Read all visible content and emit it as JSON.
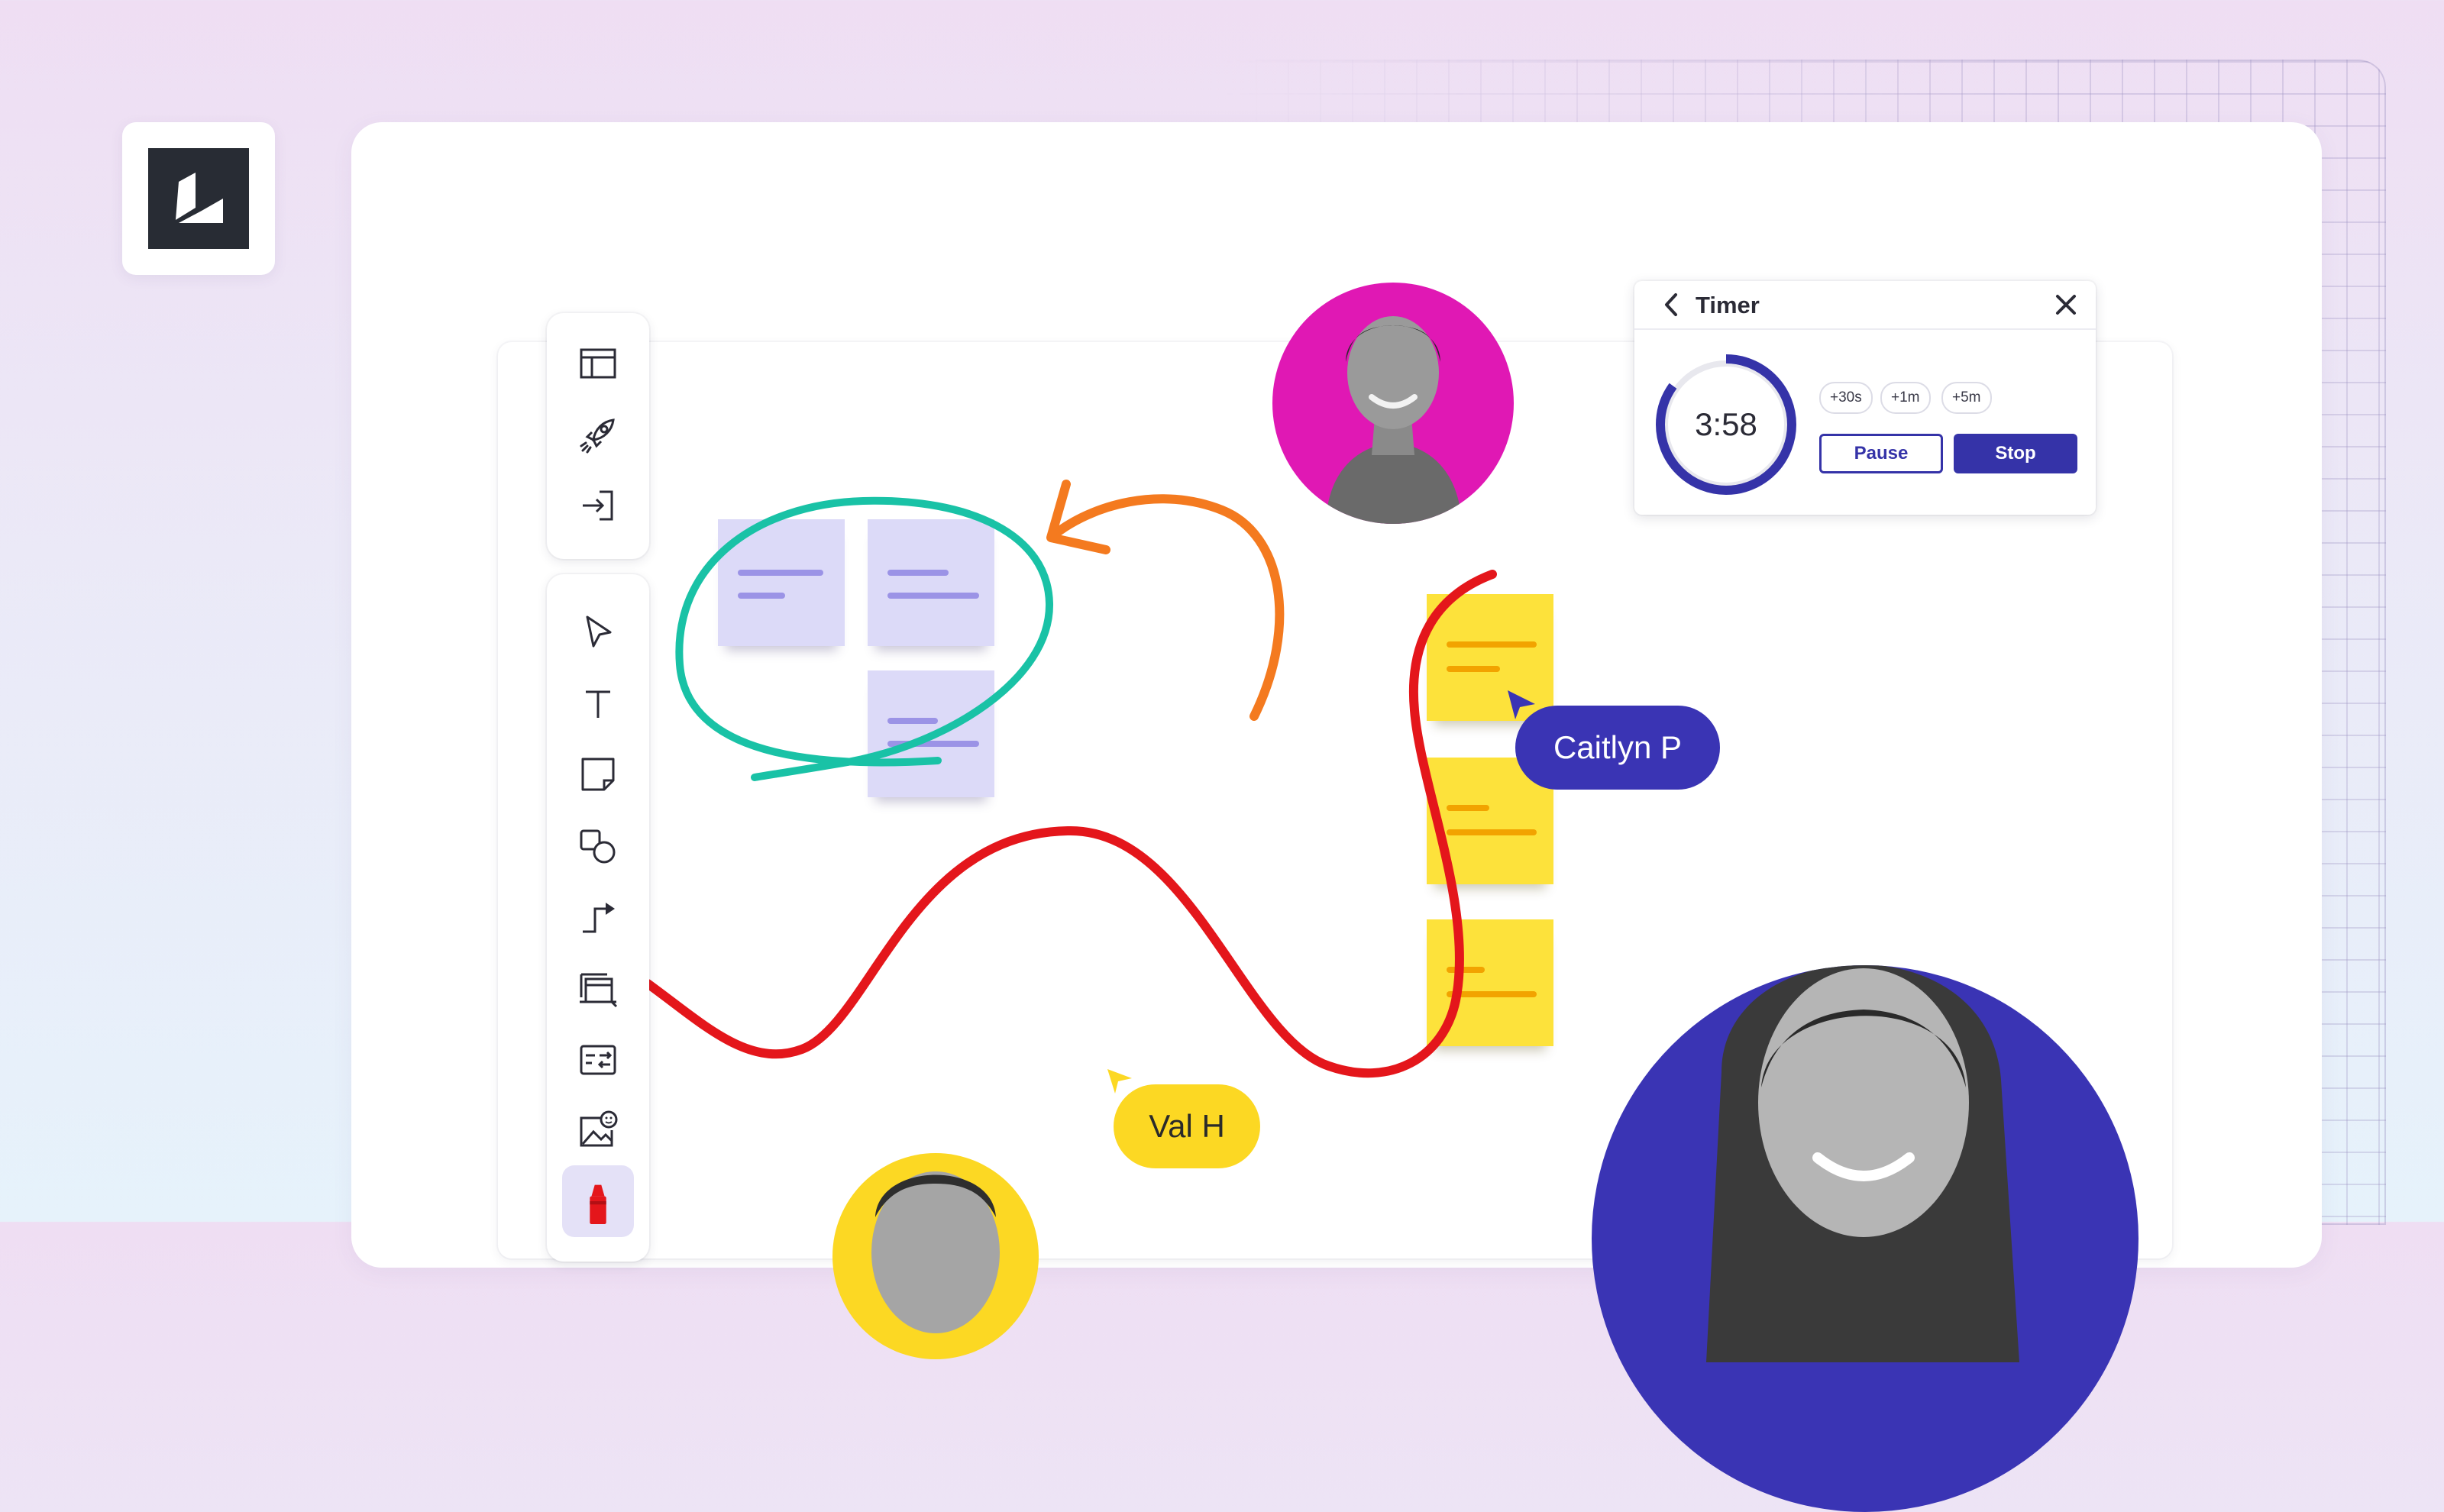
{
  "brand": {
    "logo_icon": "lucid-logo-icon",
    "colors": {
      "accent": "#3533a8",
      "highlighter_red": "#e4161b",
      "teal": "#19c2a6",
      "orange": "#f47a1f",
      "sticky_yellow": "#fde23b",
      "sticky_purple": "#dcdaf8",
      "avatar_magenta": "#e018b4",
      "avatar_blue": "#3a34b4"
    }
  },
  "toolbar": {
    "top_group": [
      {
        "icon": "layout-template-icon"
      },
      {
        "icon": "rocket-icon"
      },
      {
        "icon": "sign-in-icon"
      }
    ],
    "tools": [
      {
        "icon": "pointer-select-icon"
      },
      {
        "icon": "text-tool-icon"
      },
      {
        "icon": "sticky-note-icon"
      },
      {
        "icon": "shapes-icon"
      },
      {
        "icon": "connector-line-icon"
      },
      {
        "icon": "container-frame-icon"
      },
      {
        "icon": "card-icon"
      },
      {
        "icon": "image-sticker-icon"
      },
      {
        "icon": "highlighter-pen-icon",
        "active": true
      }
    ]
  },
  "timer": {
    "title": "Timer",
    "time": "3:58",
    "remaining_fraction": 0.85,
    "chips": [
      "+30s",
      "+1m",
      "+5m"
    ],
    "pause_label": "Pause",
    "stop_label": "Stop"
  },
  "collaborators": {
    "caitlyn": "Caitlyn P",
    "val": "Val H"
  }
}
